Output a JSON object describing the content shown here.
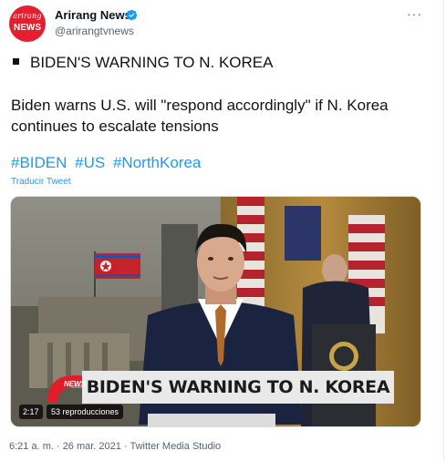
{
  "account": {
    "avatar_line1": "arirang",
    "avatar_line2": "NEWS",
    "name": "Arirang News",
    "handle": "@arirangtvnews"
  },
  "tweet": {
    "headline": "BIDEN'S WARNING TO N. KOREA",
    "body": "Biden warns U.S. will \"respond accordingly\" if N. Korea continues to escalate tensions",
    "hashtags": [
      "#BIDEN",
      "#US",
      "#NorthKorea"
    ],
    "translate_label": "Traducir Tweet"
  },
  "video": {
    "lower_third": "BIDEN'S WARNING TO N. KOREA",
    "logo_text": "NEWS",
    "duration": "2:17",
    "views": "53 reproducciones"
  },
  "footer": {
    "timestamp": "6:21 a. m. · 26 mar. 2021 · Twitter Media Studio"
  },
  "colors": {
    "link": "#1d9bf0",
    "brand_red": "#e2202f",
    "muted": "#536471"
  },
  "icons": [
    "verified-badge-icon",
    "more-options-icon",
    "black-square-icon"
  ]
}
